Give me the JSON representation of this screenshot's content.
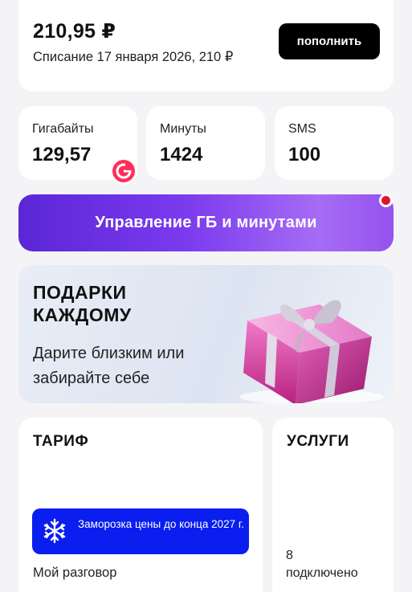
{
  "balance": {
    "amount": "210,95 ₽",
    "charge_text": "Списание 17 января 2026, 210 ₽",
    "topup_label": "пополнить"
  },
  "stats": [
    {
      "label": "Гигабайты",
      "value": "129,57"
    },
    {
      "label": "Минуты",
      "value": "1424"
    },
    {
      "label": "SMS",
      "value": "100"
    }
  ],
  "manage_banner": {
    "label": "Управление ГБ и минутами"
  },
  "gifts": {
    "title": "ПОДАРКИ КАЖДОМУ",
    "subtitle": "Дарите близким или забирайте себе"
  },
  "tariff": {
    "title": "ТАРИФ",
    "freeze_text": "Заморозка цены до конца 2027 г.",
    "name": "Мой разговор"
  },
  "services": {
    "title": "УСЛУГИ",
    "count": "8",
    "count_label": "подключено"
  },
  "colors": {
    "accent_purple": "#7b3bee",
    "freeze_blue": "#0a1ef0",
    "badge_red": "#ff2e5b",
    "notify_red": "#e0142f"
  },
  "icons": {
    "gigabyte_badge": "g-coin-icon",
    "freeze": "snowflake-icon",
    "gift": "gift-box-icon"
  }
}
